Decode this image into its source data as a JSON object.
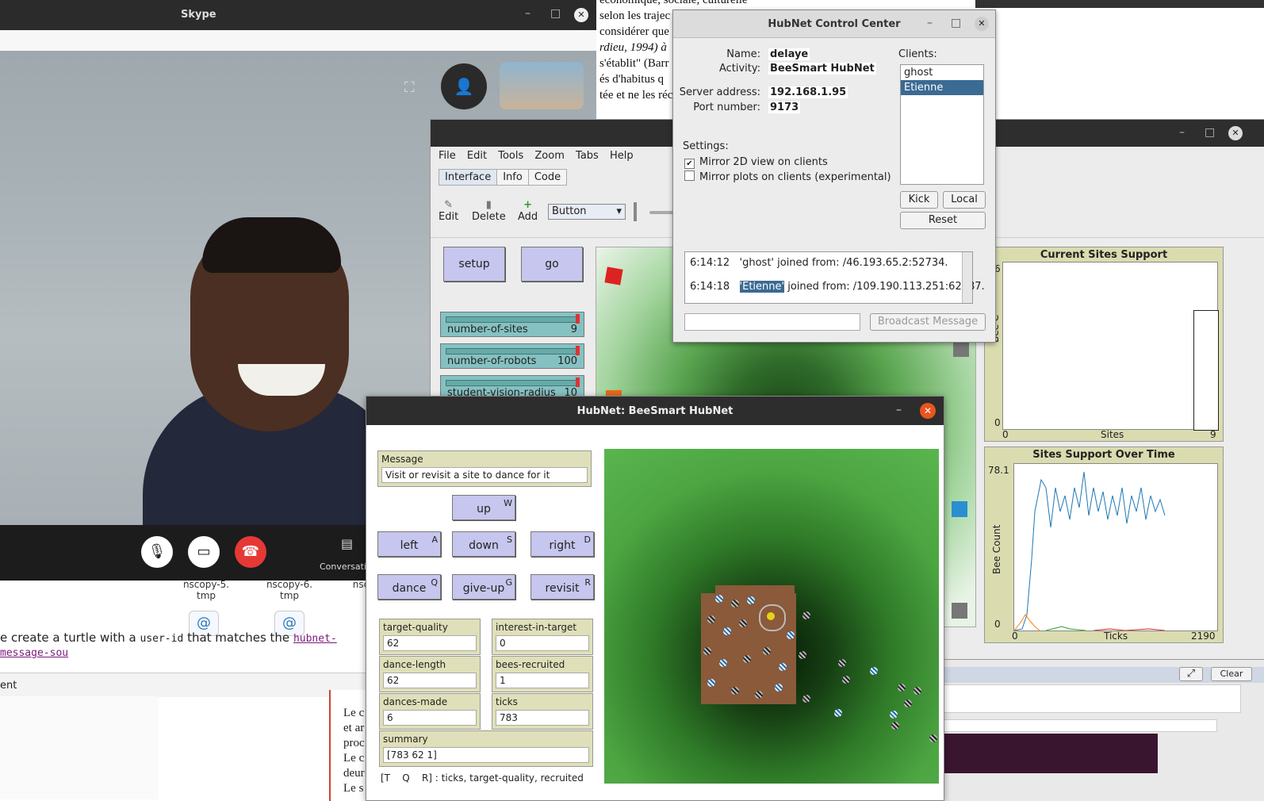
{
  "background_document": {
    "lines": [
      "économique, sociale, culturelle",
      "selon les trajec",
      "considérer que",
      "rdieu, 1994) à",
      "s'établit\" (Barr",
      "és d'habitus q",
      "tée et ne les réc"
    ]
  },
  "background_browser": {
    "files": [
      "nscopy-5.\ntmp",
      "nscopy-6.\ntmp",
      "nsc"
    ],
    "code_text_pre": "e create a turtle with a ",
    "code_inline": "user-id",
    "code_text_mid": " that matches the ",
    "code_link": "hubnet-message-sou",
    "footer_label": "ent",
    "right_doc_lines": [
      "Le c",
      "et ar",
      "proc",
      "Le c",
      "deur",
      "Le s"
    ]
  },
  "skype": {
    "title": "Skype",
    "conversation_label": "Conversatio",
    "colors": {
      "hangup": "#e53935"
    }
  },
  "netlogo": {
    "menu": [
      "File",
      "Edit",
      "Tools",
      "Zoom",
      "Tabs",
      "Help"
    ],
    "tabs": [
      "Interface",
      "Info",
      "Code"
    ],
    "active_tab": "Interface",
    "toolbar": {
      "edit": "Edit",
      "delete": "Delete",
      "add": "Add",
      "widget_type": "Button"
    },
    "buttons": {
      "setup": "setup",
      "go": "go"
    },
    "sliders": [
      {
        "label": "number-of-sites",
        "value": "9"
      },
      {
        "label": "number-of-robots",
        "value": "100"
      },
      {
        "label": "student-vision-radius",
        "value": "10"
      }
    ],
    "plot1": {
      "title": "Current Sites Support",
      "xlabel": "Sites",
      "ylabel": "Bee C",
      "xmin": "0",
      "xmax": "9",
      "ymin": "0",
      "ymax": "6"
    },
    "plot2": {
      "title": "Sites Support Over Time",
      "xlabel": "Ticks",
      "ylabel": "Bee Count",
      "xmin": "0",
      "xmax": "2190",
      "ymin": "0",
      "ymax": "78.1"
    },
    "command_center": {
      "clear": "Clear"
    }
  },
  "hubnet_control_center": {
    "title": "HubNet Control Center",
    "name_label": "Name:",
    "name": "delaye",
    "activity_label": "Activity:",
    "activity": "BeeSmart HubNet",
    "server_label": "Server address:",
    "server": "192.168.1.95",
    "port_label": "Port number:",
    "port": "9173",
    "settings_label": "Settings:",
    "mirror_2d": "Mirror 2D view on clients",
    "mirror_plots": "Mirror plots on clients (experimental)",
    "clients_label": "Clients:",
    "clients": [
      "ghost",
      "Etienne"
    ],
    "selected_client": "Etienne",
    "kick": "Kick",
    "local": "Local",
    "reset": "Reset",
    "log": [
      {
        "time": "6:14:12",
        "pre": "'ghost'",
        "msg": " joined from: /46.193.65.2:52734."
      },
      {
        "time": "6:14:18",
        "pre": "'Etienne'",
        "msg": " joined from: /109.190.113.251:62187."
      }
    ],
    "broadcast": "Broadcast Message"
  },
  "hubnet_client": {
    "title": "HubNet: BeeSmart HubNet",
    "message_label": "Message",
    "message": "Visit or revisit a site to dance for it",
    "buttons": [
      {
        "label": "up",
        "key": "W"
      },
      {
        "label": "left",
        "key": "A"
      },
      {
        "label": "down",
        "key": "S"
      },
      {
        "label": "right",
        "key": "D"
      },
      {
        "label": "dance",
        "key": "Q"
      },
      {
        "label": "give-up",
        "key": "G"
      },
      {
        "label": "revisit",
        "key": "R"
      }
    ],
    "monitors": [
      {
        "label": "target-quality",
        "value": "62"
      },
      {
        "label": "interest-in-target",
        "value": "0"
      },
      {
        "label": "dance-length",
        "value": "62"
      },
      {
        "label": "bees-recruited",
        "value": "1"
      },
      {
        "label": "dances-made",
        "value": "6"
      },
      {
        "label": "ticks",
        "value": "783"
      }
    ],
    "summary_label": "summary",
    "summary": "[783 62 1]",
    "legend": "[T    Q    R] : ticks, target-quality, recruited"
  }
}
